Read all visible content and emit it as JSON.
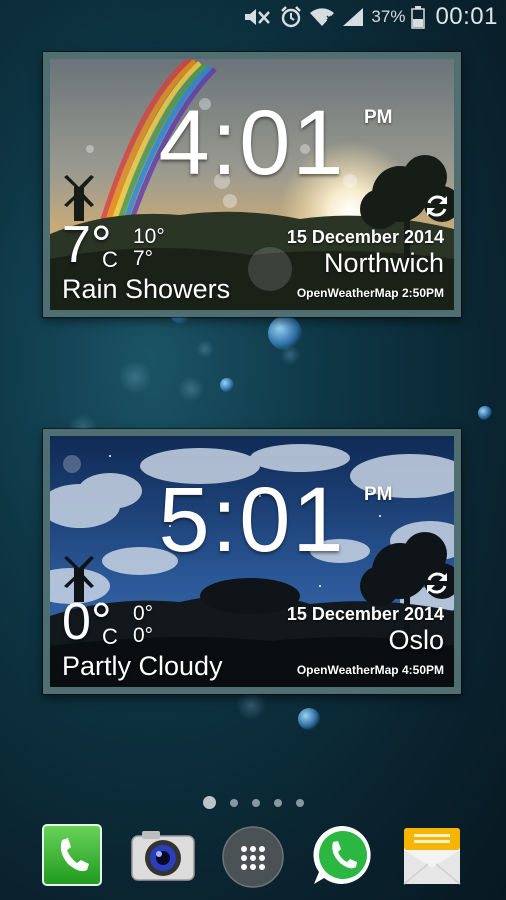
{
  "status_bar": {
    "icons": [
      "mute-icon",
      "alarm-icon",
      "wifi-icon",
      "signal-icon",
      "battery-icon"
    ],
    "battery_percent": "37%",
    "time": "00:01"
  },
  "widgets": [
    {
      "time": "4:01",
      "ampm": "PM",
      "temperature": "7°",
      "unit": "C",
      "high": "10°",
      "low": "7°",
      "condition": "Rain Showers",
      "date": "15 December 2014",
      "city": "Northwich",
      "source": "OpenWeatherMap 2:50PM",
      "scene": "sunset-rainbow"
    },
    {
      "time": "5:01",
      "ampm": "PM",
      "temperature": "0°",
      "unit": "C",
      "high": "0°",
      "low": "0°",
      "condition": "Partly Cloudy",
      "date": "15 December 2014",
      "city": "Oslo",
      "source": "OpenWeatherMap 4:50PM",
      "scene": "night-clouds"
    }
  ],
  "pager": {
    "pages": 5,
    "active": 1
  },
  "dock": [
    {
      "name": "Phone",
      "icon": "phone-icon",
      "color": "#2eb82e"
    },
    {
      "name": "Camera",
      "icon": "camera-icon",
      "color": "#c9c9c9"
    },
    {
      "name": "Apps",
      "icon": "apps-grid-icon",
      "color": "#555a5c"
    },
    {
      "name": "WhatsApp",
      "icon": "whatsapp-icon",
      "color": "#2bb741"
    },
    {
      "name": "Messages",
      "icon": "envelope-icon",
      "color": "#f4b400"
    }
  ]
}
